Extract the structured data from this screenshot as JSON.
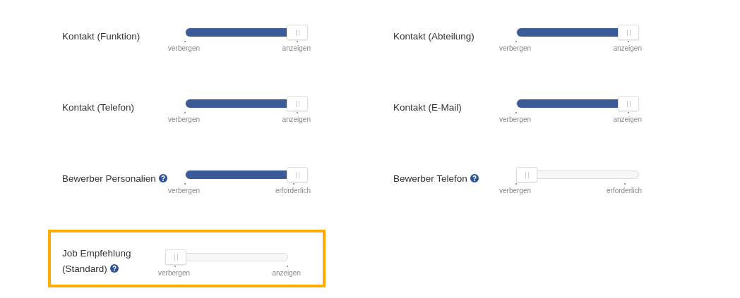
{
  "settings": [
    {
      "label": "Kontakt (Funktion)",
      "help": false,
      "level": 1,
      "min_label": "verbergen",
      "max_label": "anzeigen",
      "highlighted": false
    },
    {
      "label": "Kontakt (Abteilung)",
      "help": false,
      "level": 1,
      "min_label": "verbergen",
      "max_label": "anzeigen",
      "highlighted": false
    },
    {
      "label": "Kontakt (Telefon)",
      "help": false,
      "level": 1,
      "min_label": "verbergen",
      "max_label": "anzeigen",
      "highlighted": false
    },
    {
      "label": "Kontakt (E-Mail)",
      "help": false,
      "level": 1,
      "min_label": "verbergen",
      "max_label": "anzeigen",
      "highlighted": false
    },
    {
      "label": "Bewerber Personalien",
      "help": true,
      "level": 1,
      "min_label": "verbergen",
      "max_label": "erforderlich",
      "highlighted": false
    },
    {
      "label": "Bewerber Telefon",
      "help": true,
      "level": 0,
      "min_label": "verbergen",
      "max_label": "erforderlich",
      "highlighted": false
    },
    {
      "label": "Job Empfehlung (Standard)",
      "help": true,
      "level": 0,
      "min_label": "verbergen",
      "max_label": "anzeigen",
      "highlighted": true
    }
  ]
}
